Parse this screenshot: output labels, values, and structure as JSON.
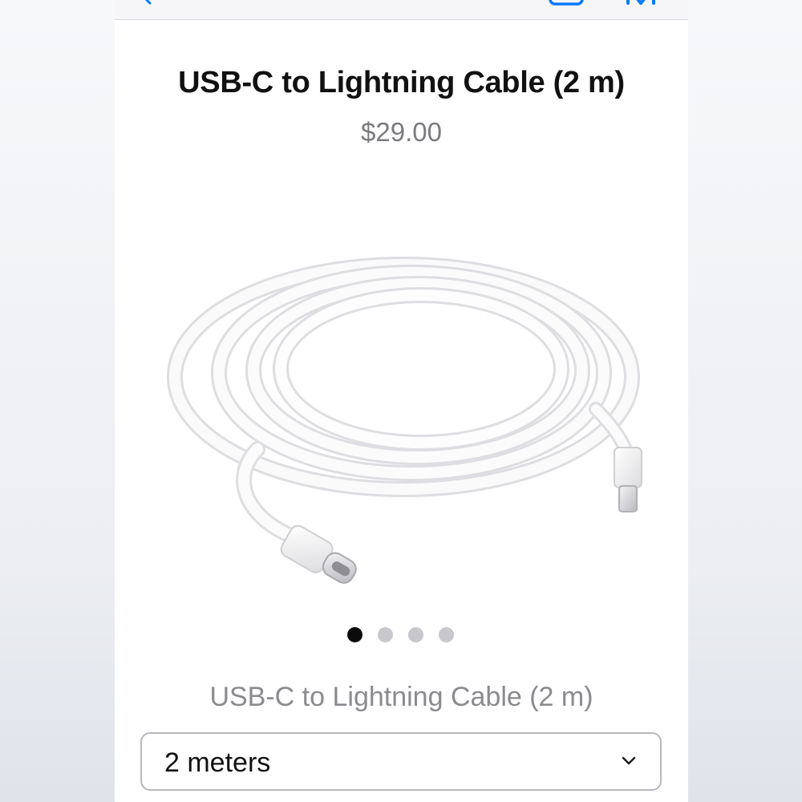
{
  "product": {
    "title": "USB-C to Lightning Cable (2 m)",
    "price": "$29.00"
  },
  "gallery": {
    "image_alt": "USB-C to Lightning Cable coiled",
    "page_count": 4,
    "active_page": 1
  },
  "options": {
    "label": "USB-C to Lightning Cable (2 m)",
    "selected": "2 meters"
  },
  "toolbar": {
    "back_icon": "chevron-left-icon",
    "share_icon": "share-icon",
    "bookmark_icon": "bookmark-icon"
  },
  "colors": {
    "accent": "#0a7aff",
    "active_dot": "#0b0b0b",
    "inactive_dot": "#c7c7cc"
  }
}
